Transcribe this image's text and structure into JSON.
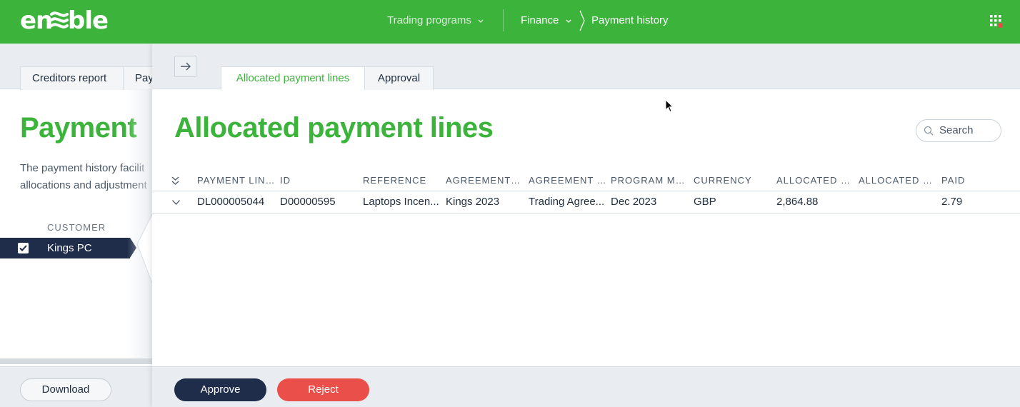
{
  "topbar": {
    "logo_text": "enable",
    "nav": {
      "trading": "Trading programs",
      "finance": "Finance",
      "current": "Payment history"
    },
    "icons": {
      "apps": "apps-grid-icon",
      "chevron": "chevron-down-icon"
    },
    "colors": {
      "brand": "#3cb43c",
      "notification": "#e94a4a"
    }
  },
  "background_panel": {
    "tabs": [
      "Creditors report",
      "Pay"
    ],
    "title": "Payment",
    "description_line1": "The payment history facilit",
    "description_line2": "allocations and adjustment",
    "column_header": "CUSTOMER",
    "selected_row": "Kings PC",
    "download_label": "Download"
  },
  "drawer": {
    "tabs": {
      "active": "Allocated payment lines",
      "inactive": "Approval"
    },
    "title": "Allocated payment lines",
    "search_placeholder": "Search",
    "columns": [
      "PAYMENT LINE...",
      "ID",
      "REFERENCE",
      "AGREEMENT R...",
      "AGREEMENT T...",
      "PROGRAM MO...",
      "CURRENCY",
      "ALLOCATED V...",
      "ALLOCATED V...",
      "PAID"
    ],
    "rows": [
      [
        "DL000005044",
        "D00000595",
        "Laptops Incen...",
        "Kings 2023",
        "Trading Agree...",
        "Dec 2023",
        "GBP",
        "2,864.88",
        "",
        "2.79"
      ]
    ],
    "approve_label": "Approve",
    "reject_label": "Reject",
    "colors": {
      "approve": "#1f2d4a",
      "reject": "#ea4f4a"
    }
  }
}
